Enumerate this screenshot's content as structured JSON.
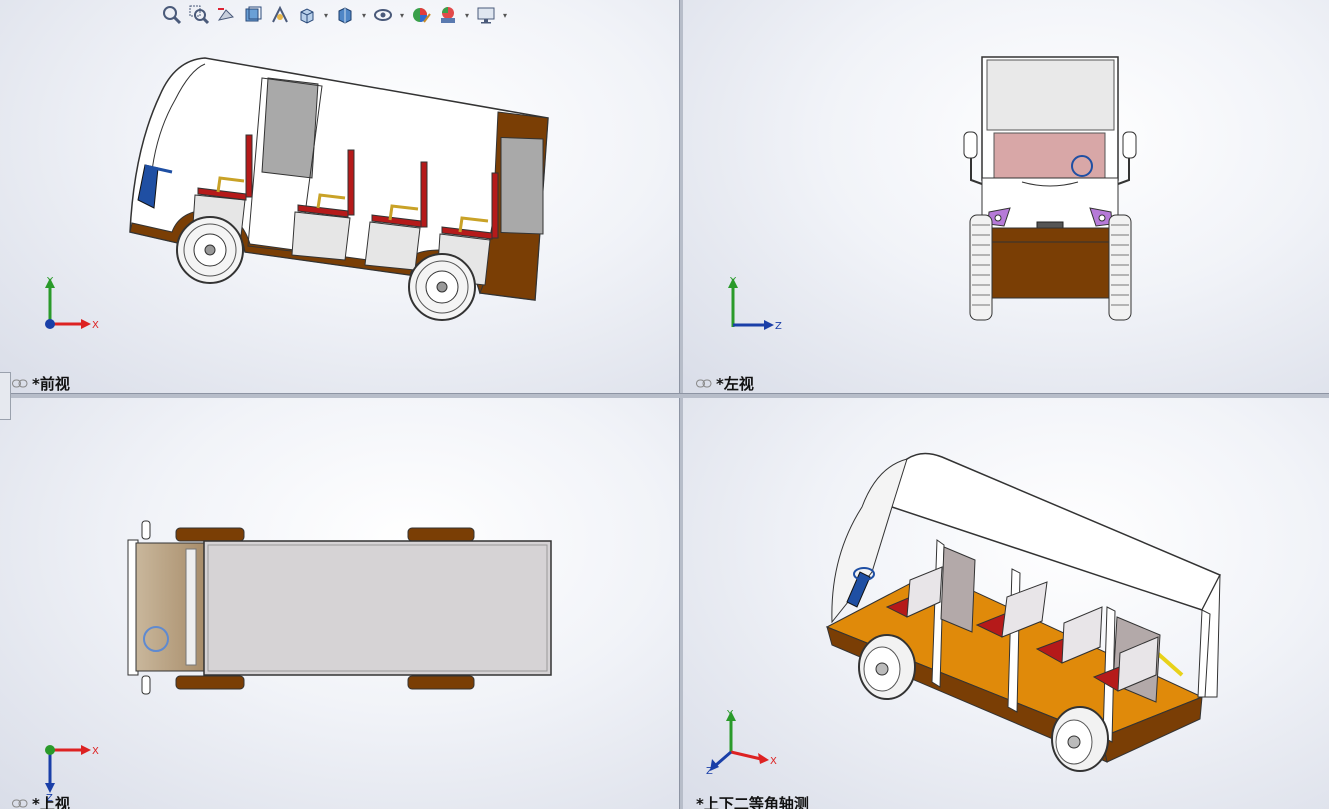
{
  "viewports": {
    "front": {
      "label": "*前视"
    },
    "left": {
      "label": "*左视"
    },
    "top": {
      "label": "*上视"
    },
    "iso": {
      "label": "*上下二等角轴测"
    }
  },
  "axes": {
    "x": "X",
    "y": "Y",
    "z": "Z"
  },
  "toolbar": {
    "buttons": [
      "zoom-to-fit-icon",
      "zoom-to-area-icon",
      "previous-view-icon",
      "section-view-icon",
      "dynamic-annotation-icon",
      "view-orientation-icon",
      "display-style-icon",
      "hide-show-items-icon",
      "edit-appearance-icon",
      "apply-scene-icon",
      "view-settings-icon"
    ]
  },
  "colors": {
    "body": "#7a3e05",
    "body_orange": "#e08a0a",
    "seat_red": "#b51a1a",
    "steering_blue": "#1f4fa3",
    "glass": "#a9a9a9",
    "roof": "#ffffff"
  }
}
